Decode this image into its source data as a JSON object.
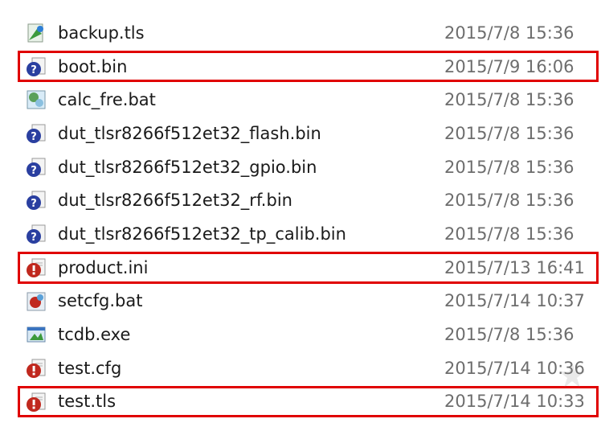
{
  "files": [
    {
      "name": "backup.tls",
      "date": "2015/7/8 15:36",
      "icon": "tls-file-icon",
      "highlighted": false
    },
    {
      "name": "boot.bin",
      "date": "2015/7/9 16:06",
      "icon": "unknown-file-icon",
      "highlighted": true
    },
    {
      "name": "calc_fre.bat",
      "date": "2015/7/8 15:36",
      "icon": "batch-file-icon",
      "highlighted": false
    },
    {
      "name": "dut_tlsr8266f512et32_flash.bin",
      "date": "2015/7/8 15:36",
      "icon": "unknown-file-icon",
      "highlighted": false
    },
    {
      "name": "dut_tlsr8266f512et32_gpio.bin",
      "date": "2015/7/8 15:36",
      "icon": "unknown-file-icon",
      "highlighted": false
    },
    {
      "name": "dut_tlsr8266f512et32_rf.bin",
      "date": "2015/7/8 15:36",
      "icon": "unknown-file-icon",
      "highlighted": false
    },
    {
      "name": "dut_tlsr8266f512et32_tp_calib.bin",
      "date": "2015/7/8 15:36",
      "icon": "unknown-file-icon",
      "highlighted": false
    },
    {
      "name": "product.ini",
      "date": "2015/7/13 16:41",
      "icon": "config-file-icon",
      "highlighted": true
    },
    {
      "name": "setcfg.bat",
      "date": "2015/7/14 10:37",
      "icon": "batch-file-icon",
      "highlighted": false
    },
    {
      "name": "tcdb.exe",
      "date": "2015/7/8 15:36",
      "icon": "exe-file-icon",
      "highlighted": false
    },
    {
      "name": "test.cfg",
      "date": "2015/7/14 10:36",
      "icon": "config-file-icon",
      "highlighted": false
    },
    {
      "name": "test.tls",
      "date": "2015/7/14 10:33",
      "icon": "config-file-icon",
      "highlighted": true
    }
  ],
  "colors": {
    "highlight_border": "#e00000",
    "name_text": "#1a1a1a",
    "date_text": "#6d6d6d"
  }
}
